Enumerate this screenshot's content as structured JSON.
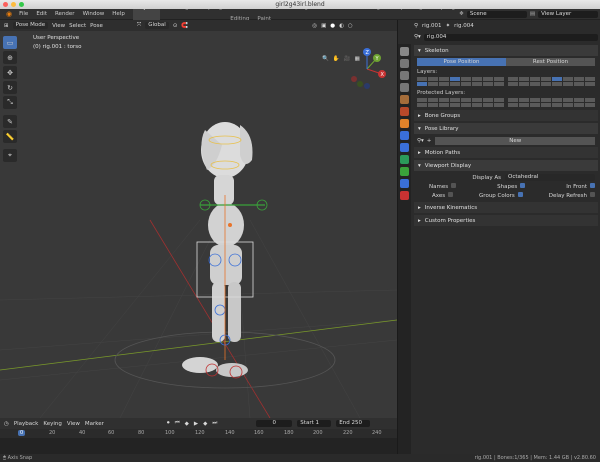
{
  "window": {
    "title": "girl2g43irl.blend"
  },
  "menubar": {
    "items": [
      "File",
      "Edit",
      "Render",
      "Window",
      "Help"
    ],
    "workspaces": [
      "Layout",
      "Modeling",
      "Sculpting",
      "UV Editing",
      "Texture Paint",
      "Shading",
      "Animation",
      "Rendering",
      "Compositing",
      "Scripting"
    ],
    "scene": "Scene",
    "view_layer": "View Layer"
  },
  "viewport": {
    "mode": "Pose Mode",
    "menus": [
      "View",
      "Select",
      "Pose"
    ],
    "orientation": "Global",
    "info_line1": "User Perspective",
    "info_line2": "(0) rig.001 : torso",
    "gizmo": {
      "x": "X",
      "y": "Y",
      "z": "Z"
    }
  },
  "timeline": {
    "menus": [
      "Playback",
      "Keying",
      "View",
      "Marker"
    ],
    "current_frame": "0",
    "start_label": "Start",
    "start": "1",
    "end_label": "End",
    "end": "250",
    "ruler": [
      "0",
      "20",
      "40",
      "60",
      "80",
      "100",
      "120",
      "140",
      "160",
      "180",
      "200",
      "220",
      "240"
    ]
  },
  "status": {
    "left": "Axis Snap",
    "right": "rig.001 | Bones:1/365 | Mem: 1.44 GB | v2.80.60"
  },
  "properties": {
    "breadcrumb_obj": "rig.001",
    "breadcrumb_data": "rig.004",
    "datablock": "rig.004",
    "skeleton": "Skeleton",
    "pose_position": "Pose Position",
    "rest_position": "Rest Position",
    "layers_label": "Layers:",
    "protected_label": "Protected Layers:",
    "bone_groups": "Bone Groups",
    "pose_library": "Pose Library",
    "new_btn": "New",
    "motion_paths": "Motion Paths",
    "viewport_display": "Viewport Display",
    "display_as_label": "Display As",
    "display_as": "Octahedral",
    "names": "Names",
    "shapes": "Shapes",
    "in_front": "In Front",
    "axes": "Axes",
    "group_colors": "Group Colors",
    "delay_refresh": "Delay Refresh",
    "ik": "Inverse Kinematics",
    "custom_props": "Custom Properties"
  },
  "colors": {
    "accent": "#4772b3",
    "bg": "#393939"
  }
}
